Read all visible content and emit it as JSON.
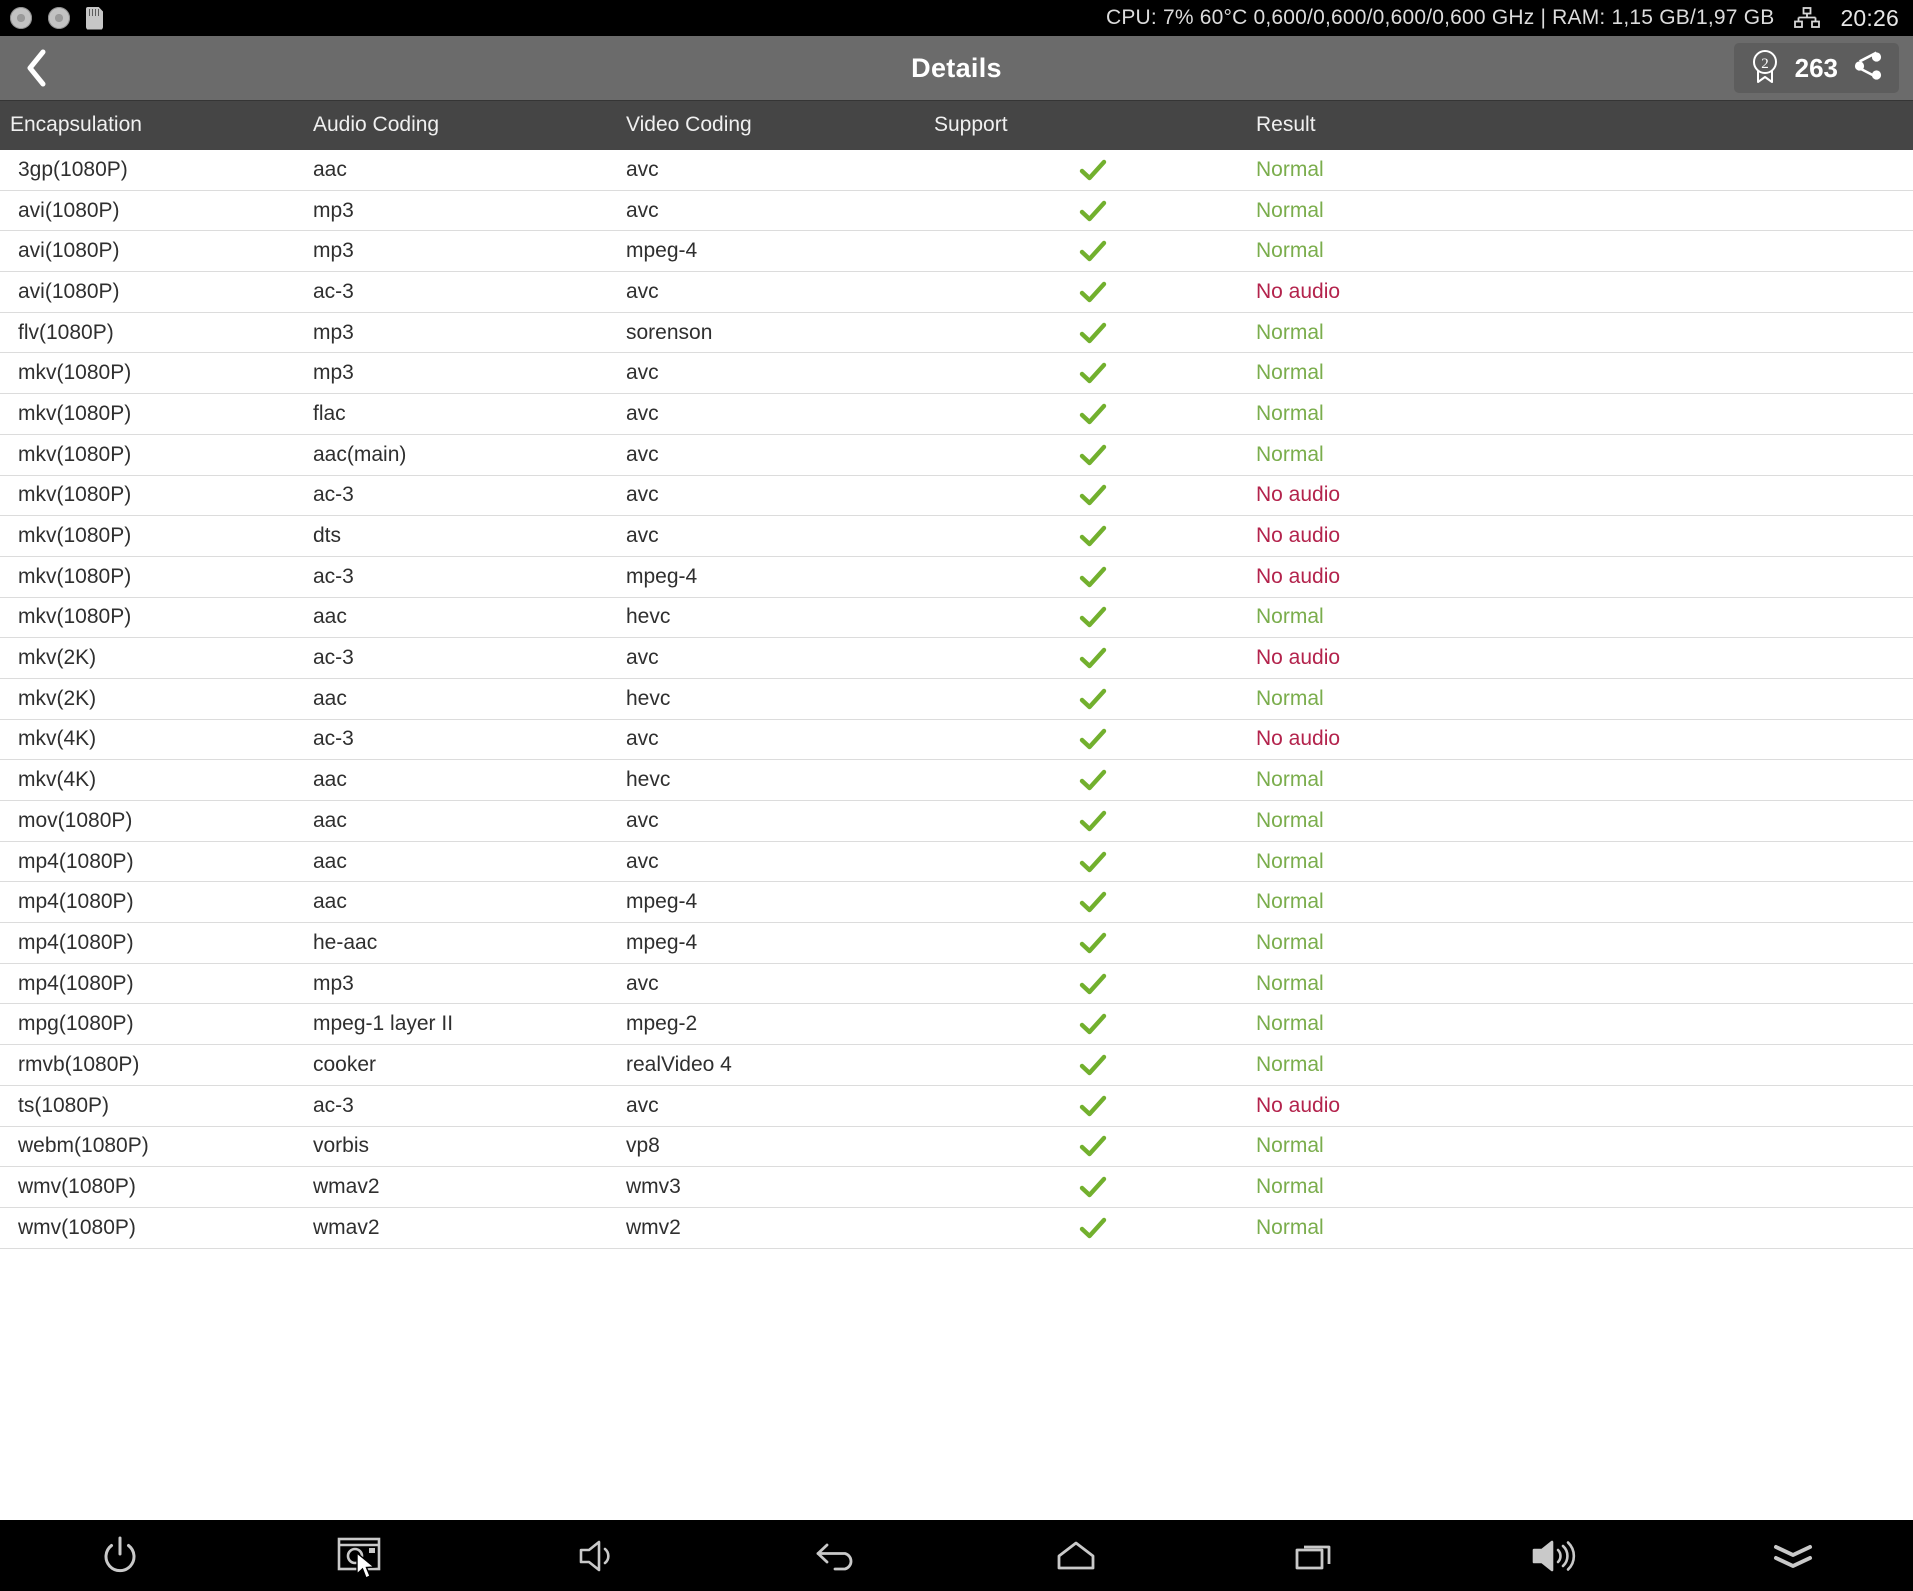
{
  "statusbar": {
    "icons": [
      "disc-icon",
      "disc-icon",
      "sd-card-icon"
    ],
    "cpu_label": "CPU:",
    "cpu_percent": "7%",
    "cpu_temp": "60°C",
    "cpu_freqs": "0,600/0,600/0,600/0,600 GHz",
    "separator": "|",
    "ram_label": "RAM:",
    "ram_value": "1,15 GB/1,97 GB",
    "network_icon": "ethernet-icon",
    "clock": "20:26",
    "full_text": "CPU:  7%  60°C 0,600/0,600/0,600/0,600 GHz | RAM: 1,15 GB/1,97 GB"
  },
  "titlebar": {
    "back_icon": "chevron-left-icon",
    "title": "Details",
    "badge_icon": "award-ribbon-2-icon",
    "badge_number": "2",
    "count": "263",
    "share_icon": "share-icon",
    "bg_color": "#6b6b6b"
  },
  "table": {
    "columns": [
      "Encapsulation",
      "Audio Coding",
      "Video Coding",
      "Support",
      "Result"
    ],
    "header_bg": "#454545",
    "support_icon": "check-icon",
    "result_colors": {
      "Normal": "#7aad4c",
      "No audio": "#b3234c"
    },
    "rows": [
      {
        "encapsulation": "3gp(1080P)",
        "audio": "aac",
        "video": "avc",
        "support": "yes",
        "result": "Normal"
      },
      {
        "encapsulation": "avi(1080P)",
        "audio": "mp3",
        "video": "avc",
        "support": "yes",
        "result": "Normal"
      },
      {
        "encapsulation": "avi(1080P)",
        "audio": "mp3",
        "video": "mpeg-4",
        "support": "yes",
        "result": "Normal"
      },
      {
        "encapsulation": "avi(1080P)",
        "audio": "ac-3",
        "video": "avc",
        "support": "yes",
        "result": "No audio"
      },
      {
        "encapsulation": "flv(1080P)",
        "audio": "mp3",
        "video": "sorenson",
        "support": "yes",
        "result": "Normal"
      },
      {
        "encapsulation": "mkv(1080P)",
        "audio": "mp3",
        "video": "avc",
        "support": "yes",
        "result": "Normal"
      },
      {
        "encapsulation": "mkv(1080P)",
        "audio": "flac",
        "video": "avc",
        "support": "yes",
        "result": "Normal"
      },
      {
        "encapsulation": "mkv(1080P)",
        "audio": "aac(main)",
        "video": "avc",
        "support": "yes",
        "result": "Normal"
      },
      {
        "encapsulation": "mkv(1080P)",
        "audio": "ac-3",
        "video": "avc",
        "support": "yes",
        "result": "No audio"
      },
      {
        "encapsulation": "mkv(1080P)",
        "audio": "dts",
        "video": "avc",
        "support": "yes",
        "result": "No audio"
      },
      {
        "encapsulation": "mkv(1080P)",
        "audio": "ac-3",
        "video": "mpeg-4",
        "support": "yes",
        "result": "No audio"
      },
      {
        "encapsulation": "mkv(1080P)",
        "audio": "aac",
        "video": "hevc",
        "support": "yes",
        "result": "Normal"
      },
      {
        "encapsulation": "mkv(2K)",
        "audio": "ac-3",
        "video": "avc",
        "support": "yes",
        "result": "No audio"
      },
      {
        "encapsulation": "mkv(2K)",
        "audio": "aac",
        "video": "hevc",
        "support": "yes",
        "result": "Normal"
      },
      {
        "encapsulation": "mkv(4K)",
        "audio": "ac-3",
        "video": "avc",
        "support": "yes",
        "result": "No audio"
      },
      {
        "encapsulation": "mkv(4K)",
        "audio": "aac",
        "video": "hevc",
        "support": "yes",
        "result": "Normal"
      },
      {
        "encapsulation": "mov(1080P)",
        "audio": "aac",
        "video": "avc",
        "support": "yes",
        "result": "Normal"
      },
      {
        "encapsulation": "mp4(1080P)",
        "audio": "aac",
        "video": "avc",
        "support": "yes",
        "result": "Normal"
      },
      {
        "encapsulation": "mp4(1080P)",
        "audio": "aac",
        "video": "mpeg-4",
        "support": "yes",
        "result": "Normal"
      },
      {
        "encapsulation": "mp4(1080P)",
        "audio": "he-aac",
        "video": "mpeg-4",
        "support": "yes",
        "result": "Normal"
      },
      {
        "encapsulation": "mp4(1080P)",
        "audio": "mp3",
        "video": "avc",
        "support": "yes",
        "result": "Normal"
      },
      {
        "encapsulation": "mpg(1080P)",
        "audio": "mpeg-1 layer II",
        "video": "mpeg-2",
        "support": "yes",
        "result": "Normal"
      },
      {
        "encapsulation": "rmvb(1080P)",
        "audio": "cooker",
        "video": "realVideo 4",
        "support": "yes",
        "result": "Normal"
      },
      {
        "encapsulation": "ts(1080P)",
        "audio": "ac-3",
        "video": "avc",
        "support": "yes",
        "result": "No audio"
      },
      {
        "encapsulation": "webm(1080P)",
        "audio": "vorbis",
        "video": "vp8",
        "support": "yes",
        "result": "Normal"
      },
      {
        "encapsulation": "wmv(1080P)",
        "audio": "wmav2",
        "video": "wmv3",
        "support": "yes",
        "result": "Normal"
      },
      {
        "encapsulation": "wmv(1080P)",
        "audio": "wmav2",
        "video": "wmv2",
        "support": "yes",
        "result": "Normal"
      }
    ]
  },
  "navbar": {
    "buttons": [
      {
        "icon": "power-icon"
      },
      {
        "icon": "screenshot-icon"
      },
      {
        "icon": "volume-down-icon"
      },
      {
        "icon": "back-icon"
      },
      {
        "icon": "home-icon"
      },
      {
        "icon": "recent-apps-icon"
      },
      {
        "icon": "volume-up-icon"
      },
      {
        "icon": "double-chevron-down-icon"
      }
    ]
  }
}
